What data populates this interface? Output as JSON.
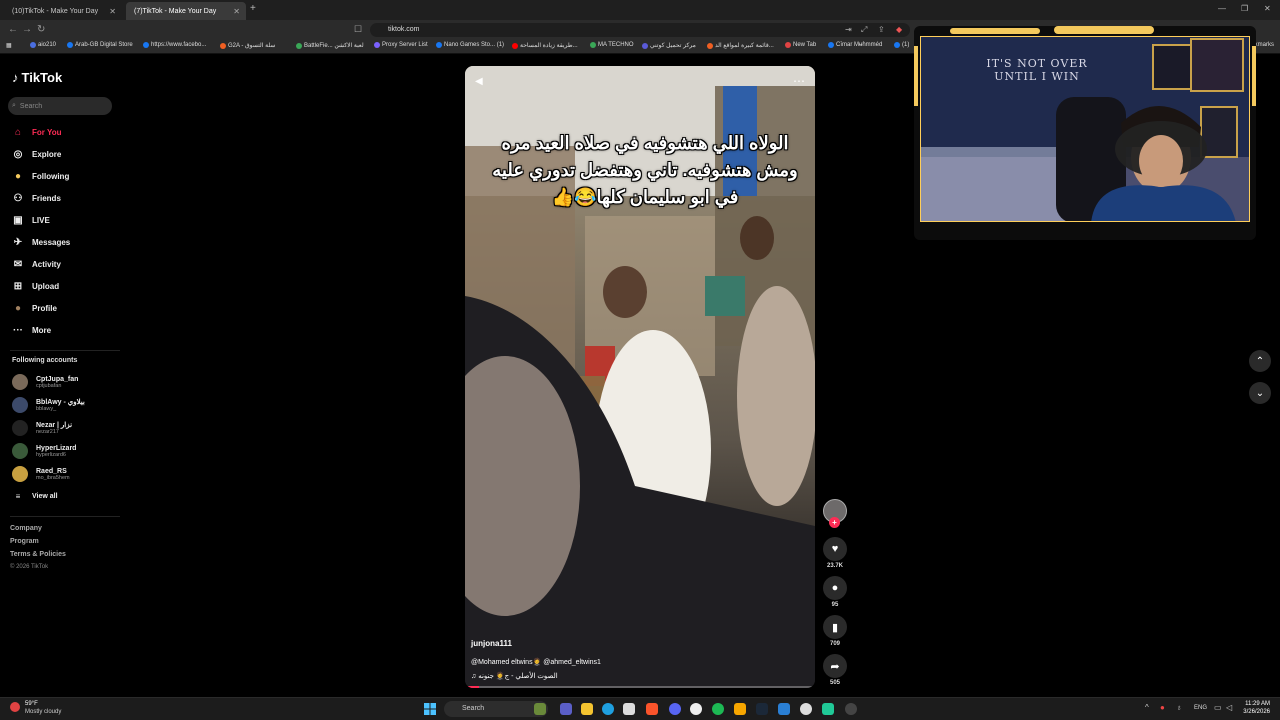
{
  "browser": {
    "tabs": [
      {
        "label": "(10)TikTok - Make Your Day"
      },
      {
        "label": "(7)TikTok - Make Your Day"
      }
    ],
    "url": "tiktok.com",
    "bookmarks": [
      {
        "label": "aio210",
        "color": "#4a6ee0"
      },
      {
        "label": "Arab-GB Digital Store",
        "color": "#1877f2"
      },
      {
        "label": "https://www.facebo...",
        "color": "#1877f2"
      },
      {
        "label": "G2A - سلة التسوق",
        "color": "#f05f22"
      },
      {
        "label": "BattleFie... لعبة الاكشن",
        "color": "#3aa757"
      },
      {
        "label": "Proxy Server List",
        "color": "#7b61ff"
      },
      {
        "label": "Nano Games Sto... (1)",
        "color": "#1877f2"
      },
      {
        "label": "طريقة زيادة المساحة...",
        "color": "#ff0000"
      },
      {
        "label": "MA TECHNO",
        "color": "#3aa757"
      },
      {
        "label": "مركز تحميل كوتني",
        "color": "#5a5ad8"
      },
      {
        "label": "قائمة كبيرة لمواقع الد...",
        "color": "#f05f22"
      },
      {
        "label": "New Tab",
        "color": "#e04343"
      },
      {
        "label": "Cīmar Mʉɦmméd",
        "color": "#1877f2"
      },
      {
        "label": "(1)",
        "color": "#1877f2"
      },
      {
        "label": "Bookmarks",
        "color": "#888888"
      }
    ]
  },
  "sidebar": {
    "logo": "TikTok",
    "search_placeholder": "Search",
    "nav": [
      {
        "label": "For You",
        "icon": "home-icon"
      },
      {
        "label": "Explore",
        "icon": "compass-icon"
      },
      {
        "label": "Following",
        "icon": "following-icon"
      },
      {
        "label": "Friends",
        "icon": "friends-icon"
      },
      {
        "label": "LIVE",
        "icon": "live-icon"
      },
      {
        "label": "Messages",
        "icon": "messages-icon"
      },
      {
        "label": "Activity",
        "icon": "activity-icon"
      },
      {
        "label": "Upload",
        "icon": "upload-icon"
      },
      {
        "label": "Profile",
        "icon": "profile-icon"
      },
      {
        "label": "More",
        "icon": "more-icon"
      }
    ],
    "following_title": "Following accounts",
    "accounts": [
      {
        "name": "CptJupa_fan",
        "handle": "cptjubafan"
      },
      {
        "name": "BblAwy - بيلاوي",
        "handle": "bblawy_"
      },
      {
        "name": "Nezar | نزار",
        "handle": "nezar217"
      },
      {
        "name": "HyperLizard",
        "handle": "hyperlizard6"
      },
      {
        "name": "Raed_RS",
        "handle": "mo_ibra5hem"
      }
    ],
    "view_all": "View all",
    "footer": [
      "Company",
      "Program",
      "Terms & Policies"
    ],
    "copyright": "© 2026 TikTok"
  },
  "video": {
    "caption": "الولاه اللي هتشوفيه في صلاه العيد مره ومش هتشوفيه. تاني وهتفضل تدوري عليه في ابو سليمان كلها😂👍",
    "username": "junjona111",
    "description": "@Mohamed eltwins🤵 @ahmed_eltwins1",
    "sound": "♫ الصوت الأصلي - ج🤵 جنونه",
    "progress": 0.04
  },
  "actions": {
    "likes": "23.7K",
    "comments": "95",
    "bookmarks": "709",
    "shares": "505"
  },
  "webcam": {
    "banner_text": "IT'S NOT OVER UNTIL I WIN"
  },
  "taskbar": {
    "weather_temp": "59°F",
    "weather_desc": "Mostly cloudy",
    "search": "Search",
    "lang": "ENG",
    "time": "11:29 AM",
    "date": "3/26/2026"
  }
}
